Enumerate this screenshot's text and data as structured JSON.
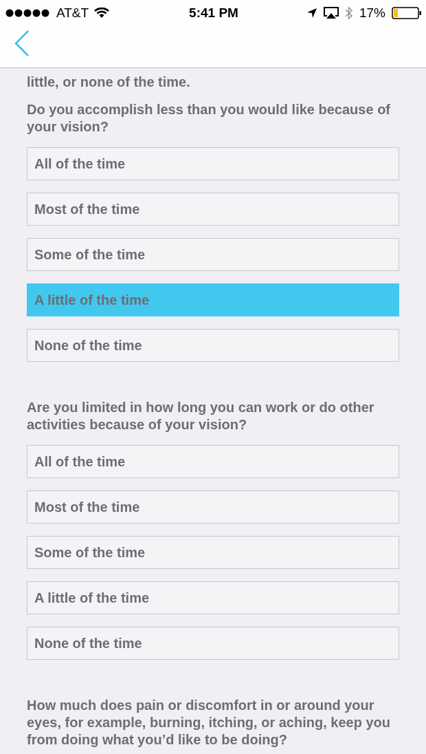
{
  "status_bar": {
    "carrier": "AT&T",
    "time": "5:41 PM",
    "battery": "17%"
  },
  "intro": "little, or none of the time.",
  "questions": [
    {
      "text": "Do you accomplish less than you would like because of your vision?",
      "options": [
        {
          "label": "All of the time",
          "selected": false
        },
        {
          "label": "Most of the time",
          "selected": false
        },
        {
          "label": "Some of the time",
          "selected": false
        },
        {
          "label": "A little of the time",
          "selected": true
        },
        {
          "label": "None of the time",
          "selected": false
        }
      ]
    },
    {
      "text": "Are you limited in how long you can work or do other activities because of your vision?",
      "options": [
        {
          "label": "All of the time",
          "selected": false
        },
        {
          "label": "Most of the time",
          "selected": false
        },
        {
          "label": "Some of the time",
          "selected": false
        },
        {
          "label": "A little of the time",
          "selected": false
        },
        {
          "label": "None of the time",
          "selected": false
        }
      ]
    },
    {
      "text": "How much does pain or discomfort in or around your eyes, for example, burning, itching, or aching, keep you from doing what you’d like to be doing?"
    }
  ]
}
